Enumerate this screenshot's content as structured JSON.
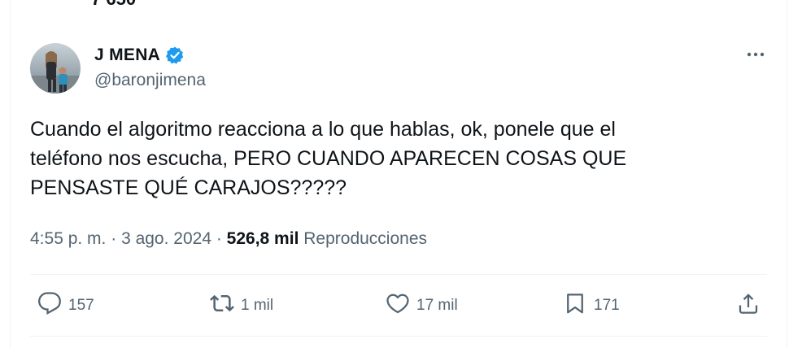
{
  "previous_tweet": {
    "snippet": "7 650"
  },
  "author": {
    "display_name": "J MENA",
    "handle": "@baronjimena",
    "verified_icon": "verified-badge-icon",
    "avatar": "profile-photo"
  },
  "tweet": {
    "text": "Cuando el algoritmo reacciona a lo que hablas, ok, ponele que el\nteléfono nos escucha, PERO CUANDO APARECEN COSAS QUE\nPENSASTE QUÉ CARAJOS?????",
    "time": "4:55 p. m.",
    "separator": " · ",
    "date": "3 ago. 2024",
    "views_count": "526,8 mil",
    "views_label": "Reproducciones"
  },
  "actions": {
    "reply_count": "157",
    "retweet_count": "1 mil",
    "like_count": "17 mil",
    "bookmark_count": "171"
  },
  "icons": {
    "more": "more-dots-icon",
    "reply": "reply-icon",
    "retweet": "retweet-icon",
    "like": "heart-icon",
    "bookmark": "bookmark-icon",
    "share": "share-icon"
  },
  "colors": {
    "text_primary": "#0f1419",
    "text_secondary": "#536471",
    "verified_blue": "#1d9bf0",
    "divider": "#eff3f4"
  }
}
